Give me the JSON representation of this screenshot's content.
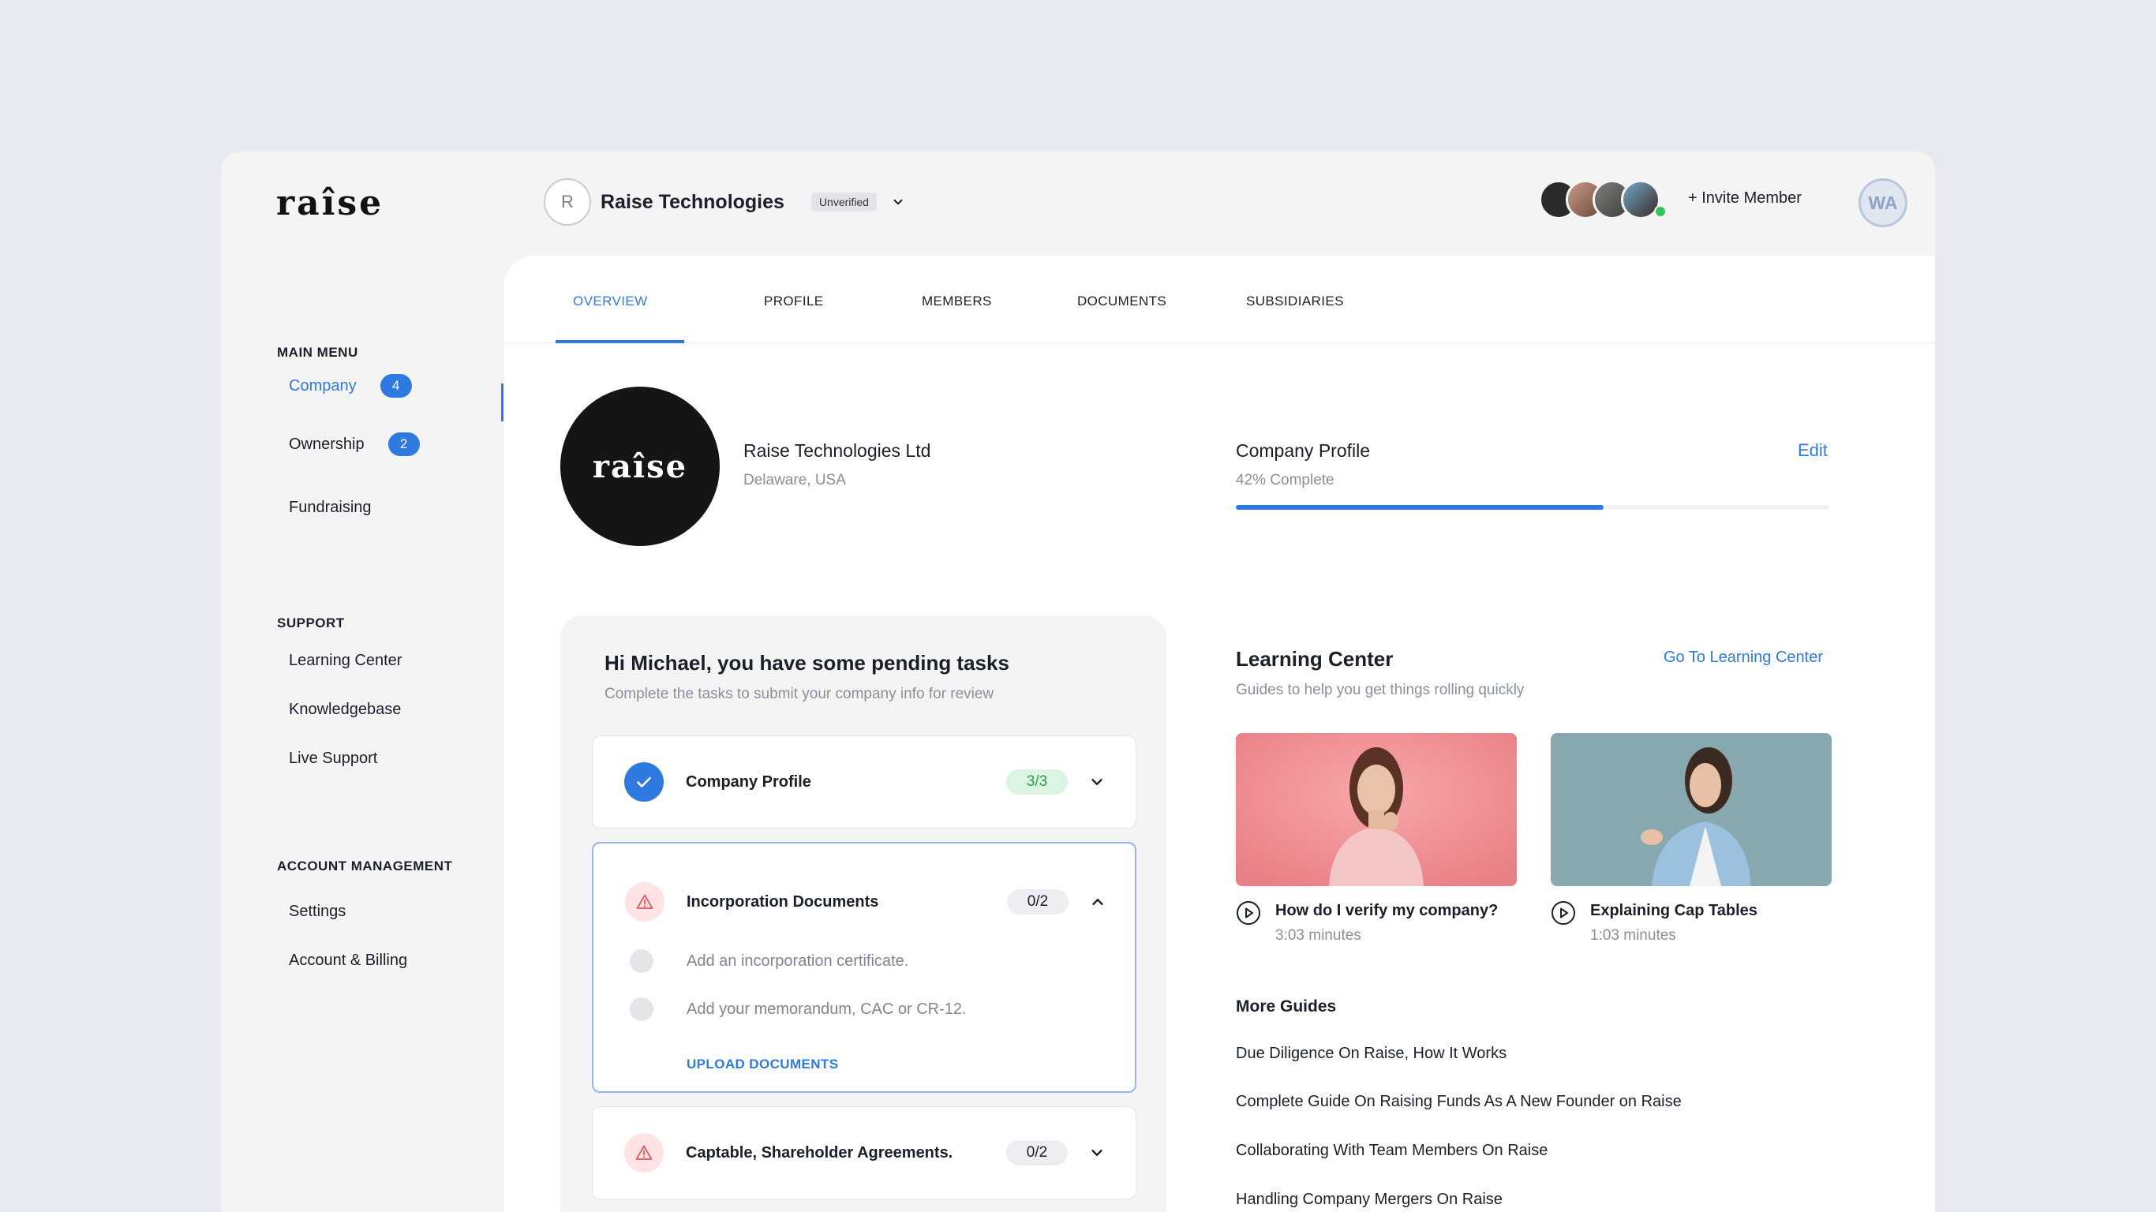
{
  "brand": {
    "logo": "raîse"
  },
  "sidebar": {
    "main_heading": "MAIN MENU",
    "main_items": [
      {
        "label": "Company",
        "badge": "4"
      },
      {
        "label": "Ownership",
        "badge": "2"
      },
      {
        "label": "Fundraising"
      }
    ],
    "support_heading": "SUPPORT",
    "support_items": [
      "Learning Center",
      "Knowledgebase",
      "Live Support"
    ],
    "account_heading": "ACCOUNT MANAGEMENT",
    "account_items": [
      "Settings",
      "Account & Billing"
    ]
  },
  "header": {
    "company_initial": "R",
    "company_name": "Raise Technologies",
    "status": "Unverified",
    "invite_label": "+ Invite Member",
    "user_initials": "WA"
  },
  "tabs": [
    "OVERVIEW",
    "PROFILE",
    "MEMBERS",
    "DOCUMENTS",
    "SUBSIDIARIES"
  ],
  "company": {
    "logo_text": "raîse",
    "legal_name": "Raise Technologies Ltd",
    "location": "Delaware, USA"
  },
  "profile_progress": {
    "title": "Company Profile",
    "percent_label": "42% Complete",
    "value": 0.62,
    "edit_label": "Edit"
  },
  "tasks": {
    "title": "Hi Michael, you have some pending tasks",
    "subtitle": "Complete the tasks to submit your company info for review",
    "items": [
      {
        "name": "Company Profile",
        "count": "3/3",
        "status": "done"
      },
      {
        "name": "Incorporation Documents",
        "count": "0/2",
        "status": "warning",
        "subtasks": [
          "Add an incorporation certificate.",
          "Add your memorandum, CAC or CR-12."
        ],
        "action": "UPLOAD DOCUMENTS"
      },
      {
        "name": "Captable, Shareholder Agreements.",
        "count": "0/2",
        "status": "warning"
      }
    ]
  },
  "learning_center": {
    "title": "Learning Center",
    "subtitle": "Guides to help you get things rolling quickly",
    "link": "Go To Learning Center",
    "videos": [
      {
        "title": "How do I verify my company?",
        "duration": "3:03 minutes"
      },
      {
        "title": "Explaining Cap Tables",
        "duration": "1:03 minutes"
      }
    ],
    "more_title": "More Guides",
    "guides": [
      "Due Diligence On Raise, How It Works",
      "Complete Guide On Raising Funds As A New Founder on Raise",
      "Collaborating With Team Members On Raise",
      "Handling Company Mergers On Raise"
    ]
  },
  "colors": {
    "accent": "#2f7ae0",
    "success": "#2f9e4f",
    "warning": "#e05a5f"
  }
}
